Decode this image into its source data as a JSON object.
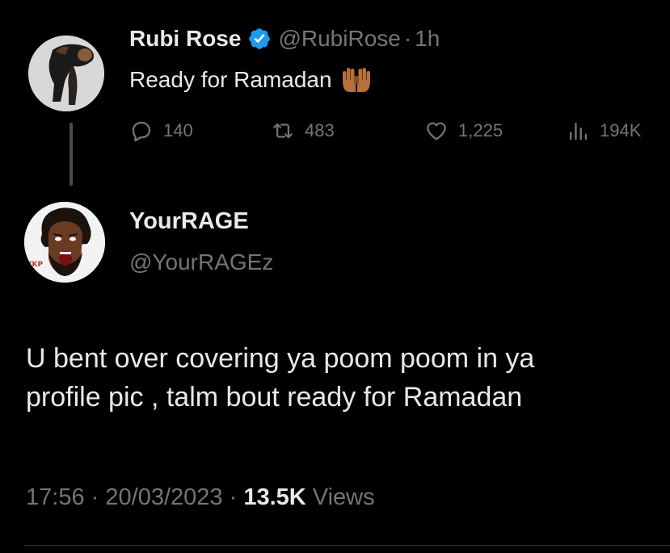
{
  "parent_tweet": {
    "display_name": "Rubi Rose",
    "handle": "@RubiRose",
    "separator": "·",
    "time": "1h",
    "text": "Ready for Ramadan",
    "emoji_icon": "raised-hands-icon",
    "verified_icon": "verified-badge-icon",
    "stats": {
      "replies": "140",
      "retweets": "483",
      "likes": "1,225",
      "views": "194K"
    }
  },
  "reply_tweet": {
    "display_name": "YourRAGE",
    "handle": "@YourRAGEz",
    "avatar_text": "YKP",
    "body_lines": [
      "U bent over covering ya poom poom in ya",
      "profile pic , talm bout ready for Ramadan"
    ],
    "timestamp": "17:56",
    "date": "20/03/2023",
    "separator": "·",
    "views_count": "13.5K",
    "views_label": "Views"
  },
  "colors": {
    "background": "#000000",
    "primary_text": "#e7e9ea",
    "secondary_text": "#71767b",
    "verified_blue": "#1d9bf0",
    "thread_line": "#4a4d52"
  }
}
